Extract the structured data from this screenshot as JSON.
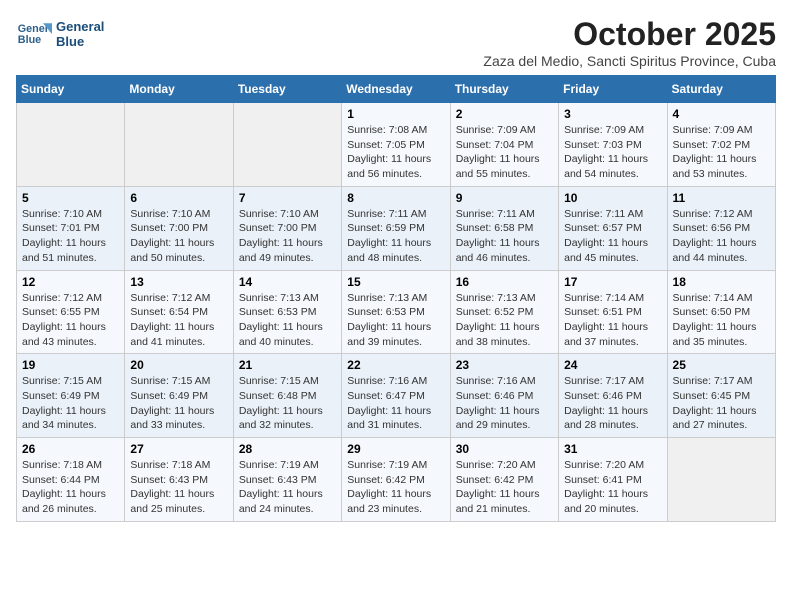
{
  "header": {
    "logo_line1": "General",
    "logo_line2": "Blue",
    "month": "October 2025",
    "location": "Zaza del Medio, Sancti Spiritus Province, Cuba"
  },
  "weekdays": [
    "Sunday",
    "Monday",
    "Tuesday",
    "Wednesday",
    "Thursday",
    "Friday",
    "Saturday"
  ],
  "weeks": [
    [
      {
        "day": "",
        "info": ""
      },
      {
        "day": "",
        "info": ""
      },
      {
        "day": "",
        "info": ""
      },
      {
        "day": "1",
        "info": "Sunrise: 7:08 AM\nSunset: 7:05 PM\nDaylight: 11 hours and 56 minutes."
      },
      {
        "day": "2",
        "info": "Sunrise: 7:09 AM\nSunset: 7:04 PM\nDaylight: 11 hours and 55 minutes."
      },
      {
        "day": "3",
        "info": "Sunrise: 7:09 AM\nSunset: 7:03 PM\nDaylight: 11 hours and 54 minutes."
      },
      {
        "day": "4",
        "info": "Sunrise: 7:09 AM\nSunset: 7:02 PM\nDaylight: 11 hours and 53 minutes."
      }
    ],
    [
      {
        "day": "5",
        "info": "Sunrise: 7:10 AM\nSunset: 7:01 PM\nDaylight: 11 hours and 51 minutes."
      },
      {
        "day": "6",
        "info": "Sunrise: 7:10 AM\nSunset: 7:00 PM\nDaylight: 11 hours and 50 minutes."
      },
      {
        "day": "7",
        "info": "Sunrise: 7:10 AM\nSunset: 7:00 PM\nDaylight: 11 hours and 49 minutes."
      },
      {
        "day": "8",
        "info": "Sunrise: 7:11 AM\nSunset: 6:59 PM\nDaylight: 11 hours and 48 minutes."
      },
      {
        "day": "9",
        "info": "Sunrise: 7:11 AM\nSunset: 6:58 PM\nDaylight: 11 hours and 46 minutes."
      },
      {
        "day": "10",
        "info": "Sunrise: 7:11 AM\nSunset: 6:57 PM\nDaylight: 11 hours and 45 minutes."
      },
      {
        "day": "11",
        "info": "Sunrise: 7:12 AM\nSunset: 6:56 PM\nDaylight: 11 hours and 44 minutes."
      }
    ],
    [
      {
        "day": "12",
        "info": "Sunrise: 7:12 AM\nSunset: 6:55 PM\nDaylight: 11 hours and 43 minutes."
      },
      {
        "day": "13",
        "info": "Sunrise: 7:12 AM\nSunset: 6:54 PM\nDaylight: 11 hours and 41 minutes."
      },
      {
        "day": "14",
        "info": "Sunrise: 7:13 AM\nSunset: 6:53 PM\nDaylight: 11 hours and 40 minutes."
      },
      {
        "day": "15",
        "info": "Sunrise: 7:13 AM\nSunset: 6:53 PM\nDaylight: 11 hours and 39 minutes."
      },
      {
        "day": "16",
        "info": "Sunrise: 7:13 AM\nSunset: 6:52 PM\nDaylight: 11 hours and 38 minutes."
      },
      {
        "day": "17",
        "info": "Sunrise: 7:14 AM\nSunset: 6:51 PM\nDaylight: 11 hours and 37 minutes."
      },
      {
        "day": "18",
        "info": "Sunrise: 7:14 AM\nSunset: 6:50 PM\nDaylight: 11 hours and 35 minutes."
      }
    ],
    [
      {
        "day": "19",
        "info": "Sunrise: 7:15 AM\nSunset: 6:49 PM\nDaylight: 11 hours and 34 minutes."
      },
      {
        "day": "20",
        "info": "Sunrise: 7:15 AM\nSunset: 6:49 PM\nDaylight: 11 hours and 33 minutes."
      },
      {
        "day": "21",
        "info": "Sunrise: 7:15 AM\nSunset: 6:48 PM\nDaylight: 11 hours and 32 minutes."
      },
      {
        "day": "22",
        "info": "Sunrise: 7:16 AM\nSunset: 6:47 PM\nDaylight: 11 hours and 31 minutes."
      },
      {
        "day": "23",
        "info": "Sunrise: 7:16 AM\nSunset: 6:46 PM\nDaylight: 11 hours and 29 minutes."
      },
      {
        "day": "24",
        "info": "Sunrise: 7:17 AM\nSunset: 6:46 PM\nDaylight: 11 hours and 28 minutes."
      },
      {
        "day": "25",
        "info": "Sunrise: 7:17 AM\nSunset: 6:45 PM\nDaylight: 11 hours and 27 minutes."
      }
    ],
    [
      {
        "day": "26",
        "info": "Sunrise: 7:18 AM\nSunset: 6:44 PM\nDaylight: 11 hours and 26 minutes."
      },
      {
        "day": "27",
        "info": "Sunrise: 7:18 AM\nSunset: 6:43 PM\nDaylight: 11 hours and 25 minutes."
      },
      {
        "day": "28",
        "info": "Sunrise: 7:19 AM\nSunset: 6:43 PM\nDaylight: 11 hours and 24 minutes."
      },
      {
        "day": "29",
        "info": "Sunrise: 7:19 AM\nSunset: 6:42 PM\nDaylight: 11 hours and 23 minutes."
      },
      {
        "day": "30",
        "info": "Sunrise: 7:20 AM\nSunset: 6:42 PM\nDaylight: 11 hours and 21 minutes."
      },
      {
        "day": "31",
        "info": "Sunrise: 7:20 AM\nSunset: 6:41 PM\nDaylight: 11 hours and 20 minutes."
      },
      {
        "day": "",
        "info": ""
      }
    ]
  ]
}
